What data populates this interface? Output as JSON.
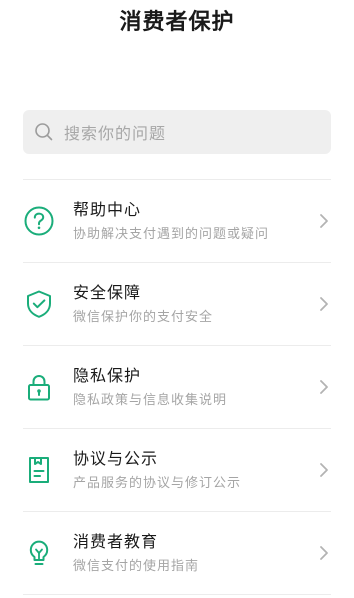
{
  "header": {
    "title": "消费者保护"
  },
  "search": {
    "placeholder": "搜索你的问题",
    "icon": "search-icon"
  },
  "colors": {
    "accent": "#1aad7a",
    "title_text": "#1a1a1a",
    "sub_text": "#a5a5a5",
    "search_bg": "#efefef",
    "divider": "#ececec"
  },
  "items": [
    {
      "title": "帮助中心",
      "subtitle": "协助解决支付遇到的问题或疑问",
      "icon": "question-circle-icon"
    },
    {
      "title": "安全保障",
      "subtitle": "微信保护你的支付安全",
      "icon": "shield-check-icon"
    },
    {
      "title": "隐私保护",
      "subtitle": "隐私政策与信息收集说明",
      "icon": "lock-icon"
    },
    {
      "title": "协议与公示",
      "subtitle": "产品服务的协议与修订公示",
      "icon": "document-icon"
    },
    {
      "title": "消费者教育",
      "subtitle": "微信支付的使用指南",
      "icon": "lightbulb-icon"
    }
  ]
}
